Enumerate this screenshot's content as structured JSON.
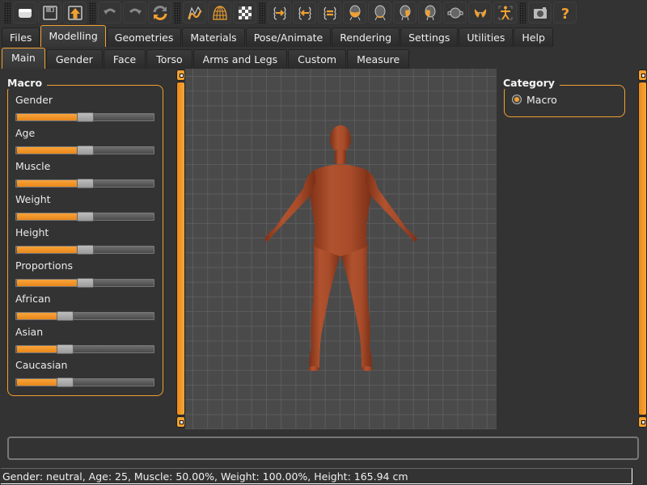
{
  "toolbar": {
    "groups": [
      [
        "open-file-icon",
        "save-icon",
        "export-icon"
      ],
      [
        "undo-icon",
        "redo-icon",
        "reset-icon"
      ],
      [
        "smooth-icon",
        "wireframe-icon",
        "background-checker-icon"
      ],
      [
        "pose-left-icon",
        "pose-right-icon",
        "pose-equal-icon",
        "front-view-icon",
        "back-view-icon",
        "left-view-icon",
        "right-view-icon",
        "top-view-icon",
        "bottom-view-icon",
        "reset-camera-icon"
      ],
      [
        "screenshot-icon",
        "help-icon"
      ]
    ],
    "accent": "#f0a030"
  },
  "main_tabs": {
    "items": [
      "Files",
      "Modelling",
      "Geometries",
      "Materials",
      "Pose/Animate",
      "Rendering",
      "Settings",
      "Utilities",
      "Help"
    ],
    "active": "Modelling"
  },
  "sub_tabs": {
    "items": [
      "Main",
      "Gender",
      "Face",
      "Torso",
      "Arms and Legs",
      "Custom",
      "Measure"
    ],
    "active": "Main"
  },
  "macro": {
    "title": "Macro",
    "sliders": [
      {
        "label": "Gender",
        "value": 0.5
      },
      {
        "label": "Age",
        "value": 0.5
      },
      {
        "label": "Muscle",
        "value": 0.5
      },
      {
        "label": "Weight",
        "value": 0.5
      },
      {
        "label": "Height",
        "value": 0.5
      },
      {
        "label": "Proportions",
        "value": 0.5
      },
      {
        "label": "African",
        "value": 0.333
      },
      {
        "label": "Asian",
        "value": 0.333
      },
      {
        "label": "Caucasian",
        "value": 0.333
      }
    ]
  },
  "category": {
    "title": "Category",
    "options": [
      {
        "label": "Macro",
        "selected": true
      }
    ]
  },
  "bottom_field": {
    "value": ""
  },
  "status": {
    "text": "Gender: neutral, Age: 25, Muscle: 50.00%, Weight: 100.00%, Height: 165.94 cm"
  },
  "colors": {
    "accent": "#f0a030",
    "background": "#333333",
    "viewport": "#4a4a4a",
    "skin": "#a4492a"
  }
}
